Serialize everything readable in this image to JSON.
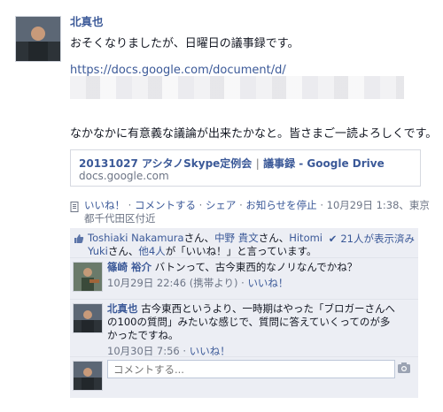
{
  "post": {
    "author": "北真也",
    "line1": "おそくなりましたが、日曜日の議事録です。",
    "doc_url": "https://docs.google.com/document/d/",
    "message": "なかなかに有意義な議論が出来たかなと。皆さまご一読よろしくです。",
    "share": {
      "title_part1": "20131027 アシタノSkype定例会",
      "title_sep": "|",
      "title_part2": "議事録 - Google Drive",
      "domain": "docs.google.com"
    },
    "actions": {
      "like": "いいね！",
      "comment": "コメントする",
      "share": "シェア",
      "stop_notifications": "お知らせを停止",
      "timestamp": "10月29日 1:38",
      "location": "東京都千代田区付近"
    }
  },
  "likes": {
    "user1": "Toshiaki Nakamura",
    "user2": "中野 貴文",
    "user3": "Hitomi Yuki",
    "others": "他4人",
    "text_san": "さん、",
    "text_san2": "さん、",
    "text_san3": "さん、",
    "text_tail": "が「いいね！」と言っています。",
    "seen": "21人が表示済み"
  },
  "comments": [
    {
      "name": "篠崎 裕介",
      "text": "バトンって、古今東西的なノリなんでかね？",
      "time": "10月29日 22:46 (携帯より)",
      "like": "いいね！"
    },
    {
      "name": "北真也",
      "text": "古今東西というより、一時期はやった「ブロガーさんへの100の質問」みたいな感じで、質問に答えていくってのが多かったですね。",
      "time": "10月30日 7:56",
      "like": "いいね！"
    }
  ],
  "compose": {
    "placeholder": "コメントする..."
  },
  "colors": {
    "link": "#3b5998",
    "meta": "#6d7586",
    "feedback_bg": "#eceef4"
  }
}
